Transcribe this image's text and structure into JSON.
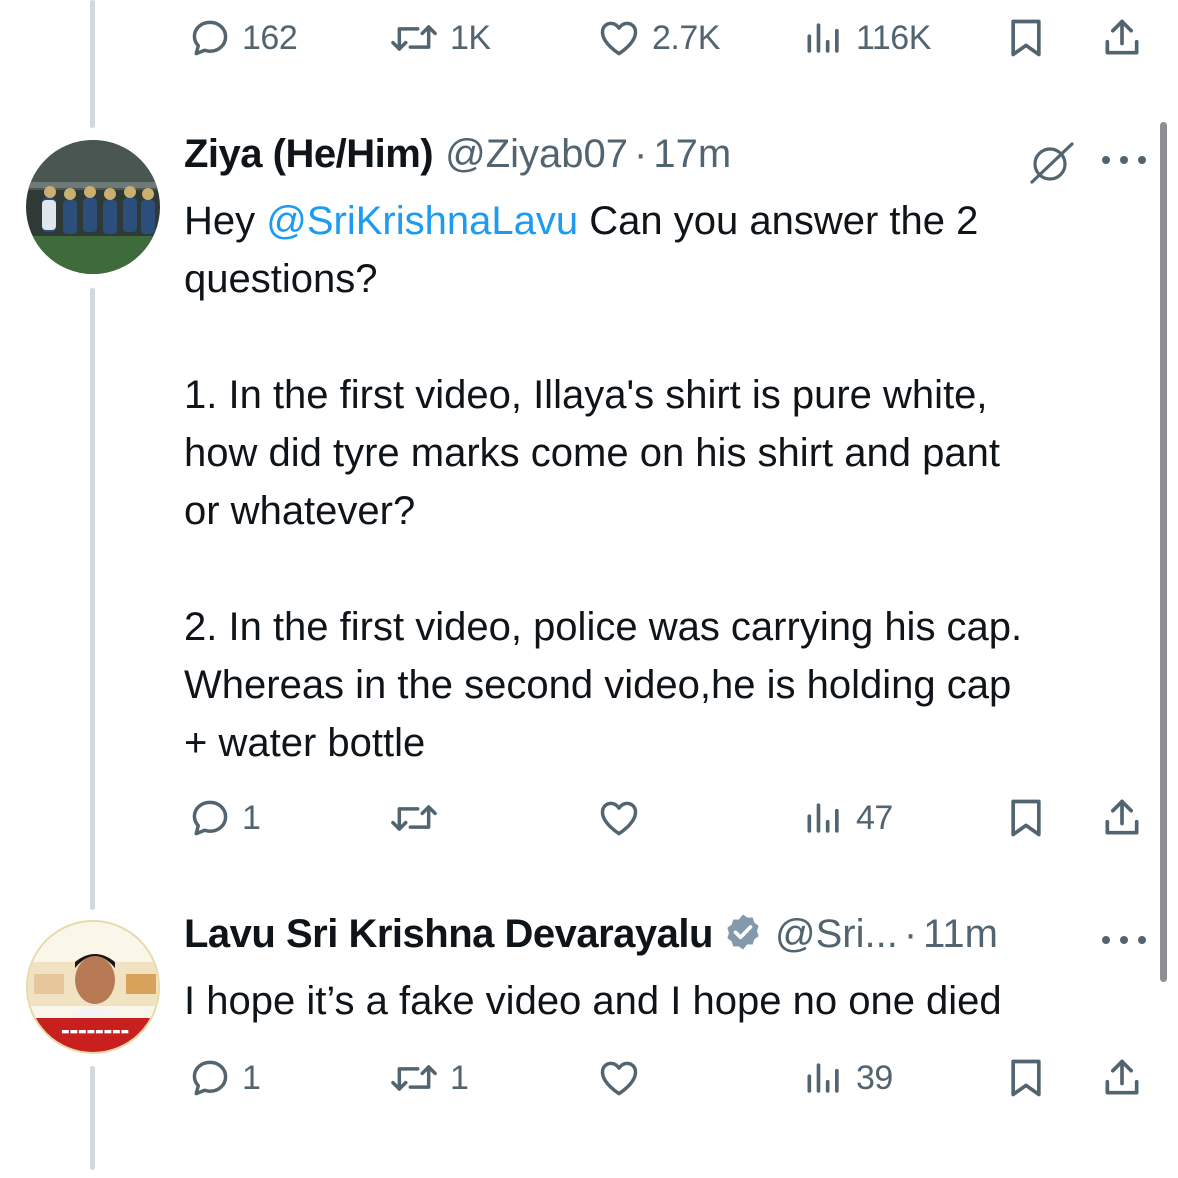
{
  "top_actions": {
    "replies": "162",
    "retweets": "1K",
    "likes": "2.7K",
    "views": "116K"
  },
  "tweet1": {
    "display_name": "Ziya (He/Him)",
    "handle": "@Ziyab07",
    "separator": "·",
    "time": "17m",
    "text_prefix": "Hey ",
    "mention": "@SriKrishnaLavu",
    "text_rest": " Can you answer the 2\nquestions?\n\n1. In the first video, Illaya's shirt is pure white,\nhow did tyre marks come on his shirt and pant\nor whatever?\n\n2. In the first video, police was carrying his cap.\nWhereas in the second video,he is holding cap\n+ water bottle",
    "actions": {
      "replies": "1",
      "retweets": "",
      "likes": "",
      "views": "47"
    }
  },
  "tweet2": {
    "display_name": "Lavu Sri Krishna Devarayalu",
    "handle": "@Sri...",
    "separator": "·",
    "time": "11m",
    "text": "I hope it’s a fake video and I hope no one died",
    "actions": {
      "replies": "1",
      "retweets": "1",
      "likes": "",
      "views": "39"
    }
  },
  "colors": {
    "text": "#0f1419",
    "secondary": "#536471",
    "link": "#1d9bf0",
    "verified": "#829aab",
    "thread_line": "#cfd9de"
  }
}
